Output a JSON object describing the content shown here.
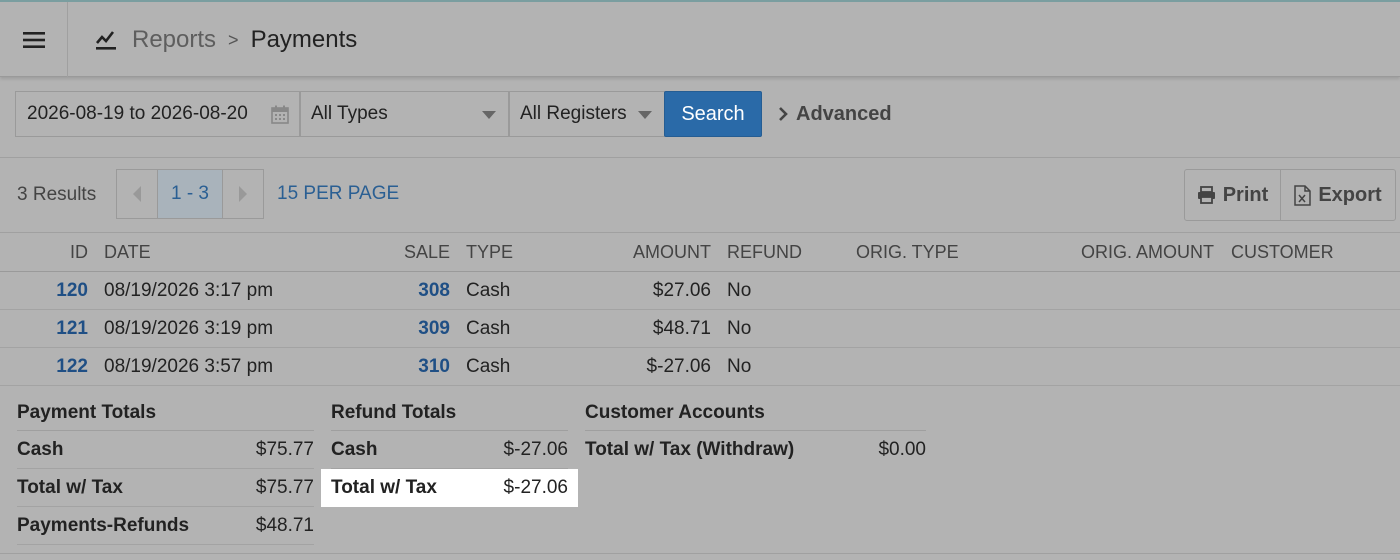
{
  "header": {
    "breadcrumb_root": "Reports",
    "breadcrumb_separator": ">",
    "breadcrumb_current": "Payments"
  },
  "filters": {
    "date_range": "2026-08-19 to 2026-08-20",
    "type_select": "All Types",
    "register_select": "All Registers",
    "search_label": "Search",
    "advanced_label": "Advanced"
  },
  "results": {
    "count_label": "3 Results",
    "page_range": "1 - 3",
    "per_page": "15 PER PAGE",
    "print_label": "Print",
    "export_label": "Export"
  },
  "table": {
    "columns": [
      "ID",
      "DATE",
      "SALE",
      "TYPE",
      "AMOUNT",
      "REFUND",
      "ORIG. TYPE",
      "ORIG. AMOUNT",
      "CUSTOMER"
    ],
    "rows": [
      {
        "id": "120",
        "date": "08/19/2026 3:17 pm",
        "sale": "308",
        "type": "Cash",
        "amount": "$27.06",
        "refund": "No",
        "orig_type": "",
        "orig_amount": "",
        "customer": ""
      },
      {
        "id": "121",
        "date": "08/19/2026 3:19 pm",
        "sale": "309",
        "type": "Cash",
        "amount": "$48.71",
        "refund": "No",
        "orig_type": "",
        "orig_amount": "",
        "customer": ""
      },
      {
        "id": "122",
        "date": "08/19/2026 3:57 pm",
        "sale": "310",
        "type": "Cash",
        "amount": "$-27.06",
        "refund": "No",
        "orig_type": "",
        "orig_amount": "",
        "customer": ""
      }
    ]
  },
  "totals": {
    "payment": {
      "title": "Payment Totals",
      "rows": [
        {
          "label": "Cash",
          "value": "$75.77"
        },
        {
          "label": "Total w/ Tax",
          "value": "$75.77"
        },
        {
          "label": "Payments-Refunds",
          "value": "$48.71"
        }
      ]
    },
    "refund": {
      "title": "Refund Totals",
      "rows": [
        {
          "label": "Cash",
          "value": "$-27.06"
        },
        {
          "label": "Total w/ Tax",
          "value": "$-27.06"
        }
      ]
    },
    "customer_accounts": {
      "title": "Customer Accounts",
      "rows": [
        {
          "label": "Total w/ Tax (Withdraw)",
          "value": "$0.00"
        }
      ]
    }
  },
  "colors": {
    "overlay_bg": "#b3b3b3",
    "accent": "#2a6aa8",
    "link": "#1f4f85",
    "highlight": "#ffffff"
  },
  "icons": [
    "menu-icon",
    "reports-chart-icon",
    "calendar-icon",
    "chevron-right-icon",
    "prev-page-icon",
    "next-page-icon",
    "print-icon",
    "export-icon"
  ]
}
